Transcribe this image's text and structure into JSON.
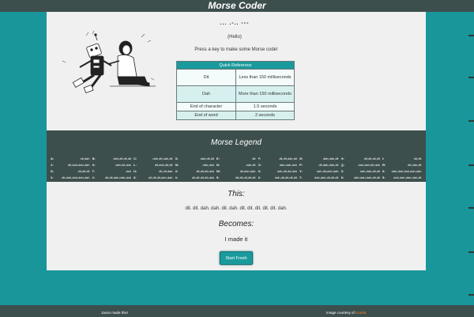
{
  "header": {
    "title": "Morse Coder"
  },
  "hero": {
    "morse_output": "... .-.. ---",
    "hello_text": "(Hello)",
    "prompt": "Press a key to make some Morse code!",
    "illustration_icon": "girl-with-robot-illustration"
  },
  "quick_reference": {
    "title": "Quick Reference",
    "rows": [
      {
        "term": "Dit",
        "value": "Less than 150 milliseconds"
      },
      {
        "term": "Dah",
        "value": "More than 150 milliseconds"
      },
      {
        "term": "End of character",
        "value": "1.5 seconds"
      },
      {
        "term": "End of word",
        "value": "2 seconds"
      }
    ]
  },
  "legend": {
    "title": "Morse Legend",
    "items": [
      {
        "letter": "A:",
        "code": "dit,dah"
      },
      {
        "letter": "B:",
        "code": "dah,dit,dit,dit"
      },
      {
        "letter": "C:",
        "code": "dah,dit,dah,dit"
      },
      {
        "letter": "D:",
        "code": "dah,dit,dit"
      },
      {
        "letter": "E:",
        "code": "dit"
      },
      {
        "letter": "F:",
        "code": "dit,dit,dah,dit"
      },
      {
        "letter": "G:",
        "code": "dah,dah,dit"
      },
      {
        "letter": "H:",
        "code": "dit,dit,dit,dit"
      },
      {
        "letter": "I:",
        "code": "dit,dit"
      },
      {
        "letter": "J:",
        "code": "dit,dah,dah,dah"
      },
      {
        "letter": "K:",
        "code": "dah,dit,dah"
      },
      {
        "letter": "L:",
        "code": "dit,dah,dit,dit"
      },
      {
        "letter": "M:",
        "code": "dah,dah"
      },
      {
        "letter": "N:",
        "code": "dah,dit"
      },
      {
        "letter": "O:",
        "code": "dah,dah,dah"
      },
      {
        "letter": "P:",
        "code": "dit,dah,dah,dit"
      },
      {
        "letter": "Q:",
        "code": "dah,dah,dit,dah"
      },
      {
        "letter": "R:",
        "code": "dit,dah,dit"
      },
      {
        "letter": "S:",
        "code": "dit,dit,dit"
      },
      {
        "letter": "T:",
        "code": "dah"
      },
      {
        "letter": "U:",
        "code": "dit,dit,dah"
      },
      {
        "letter": "V:",
        "code": "dit,dit,dit,dah"
      },
      {
        "letter": "W:",
        "code": "dit,dah,dah"
      },
      {
        "letter": "X:",
        "code": "dah,dit,dit,dah"
      },
      {
        "letter": "Y:",
        "code": "dah,dit,dah,dah"
      },
      {
        "letter": "Z:",
        "code": "dah,dah,dit,dit"
      },
      {
        "letter": "0:",
        "code": "dah,dah,dah,dah,dah"
      },
      {
        "letter": "1:",
        "code": "dit,dah,dah,dah,dah"
      },
      {
        "letter": "2:",
        "code": "dit,dit,dah,dah,dah"
      },
      {
        "letter": "3:",
        "code": "dit,dit,dit,dah,dah"
      },
      {
        "letter": "4:",
        "code": "dit,dit,dit,dit,dah"
      },
      {
        "letter": "5:",
        "code": "dit,dit,dit,dit,dit"
      },
      {
        "letter": "6:",
        "code": "dah,dit,dit,dit,dit"
      },
      {
        "letter": "7:",
        "code": "dah,dah,dit,dit,dit"
      },
      {
        "letter": "8:",
        "code": "dah,dah,dah,dit,dit"
      },
      {
        "letter": "9:",
        "code": "dah,dah,dah,dah,dit"
      }
    ]
  },
  "translation": {
    "this_label": "This:",
    "input_sequence": "dit. dit. dah. dah. dit. dah. dit. dit. dit. dit. dit. dah.",
    "becomes_label": "Becomes:",
    "result_text": "I made it",
    "start_button": "Start Fresh"
  },
  "footer": {
    "left_credit": "Jason made this!",
    "right_credit_prefix": "Image courtesy of ",
    "right_credit_link": "icons8."
  },
  "colors": {
    "page_background": "#19969a",
    "bar_background": "#3d4f4d",
    "accent": "#1a9a9d",
    "card_background": "#f0f0f0",
    "link": "#ff8a2a"
  }
}
